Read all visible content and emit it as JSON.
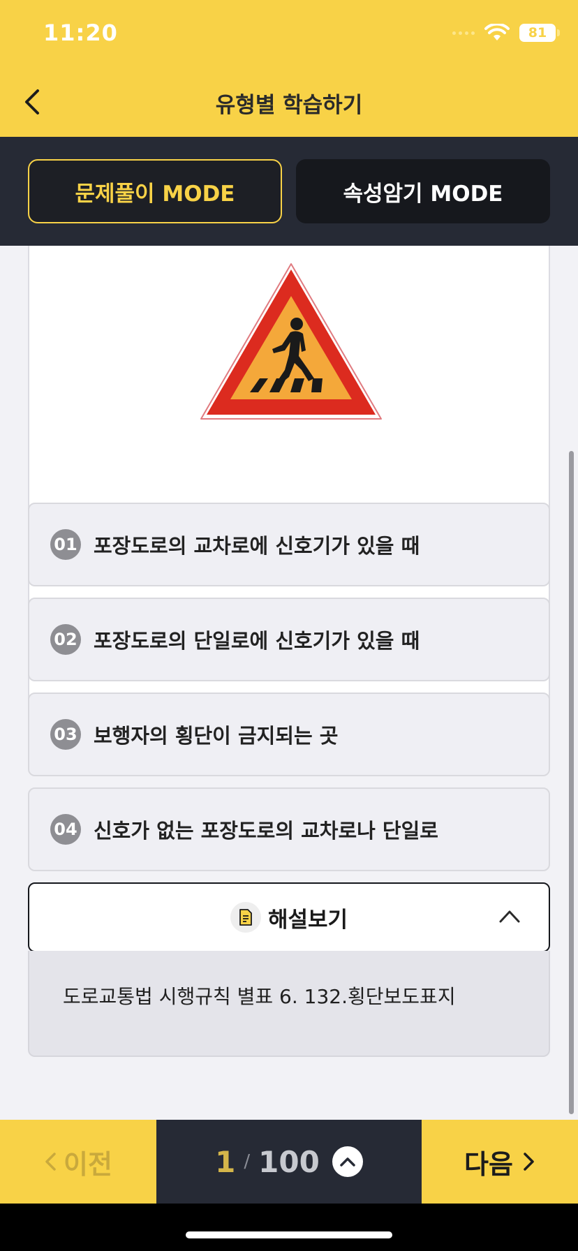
{
  "status_bar": {
    "time": "11:20",
    "battery": "81"
  },
  "header": {
    "title": "유형별 학습하기"
  },
  "modes": {
    "active_label": "문제풀이 MODE",
    "inactive_label": "속성암기 MODE"
  },
  "options": [
    {
      "num": "01",
      "text": "포장도로의 교차로에 신호기가 있을 때"
    },
    {
      "num": "02",
      "text": "포장도로의 단일로에 신호기가 있을 때"
    },
    {
      "num": "03",
      "text": "보행자의 횡단이 금지되는 곳"
    },
    {
      "num": "04",
      "text": "신호가 없는 포장도로의 교차로나 단일로"
    }
  ],
  "explanation": {
    "label": "해설보기",
    "body": "도로교통법 시행규칙 별표 6. 132.횡단보도표지"
  },
  "bottom_nav": {
    "prev_label": "이전",
    "next_label": "다음",
    "current_page": "1",
    "separator": "/",
    "total_pages": "100"
  },
  "colors": {
    "brand_yellow": "#f8d247",
    "dark": "#262a35",
    "sign_red": "#dc2b1f",
    "sign_orange": "#f4a83a"
  }
}
